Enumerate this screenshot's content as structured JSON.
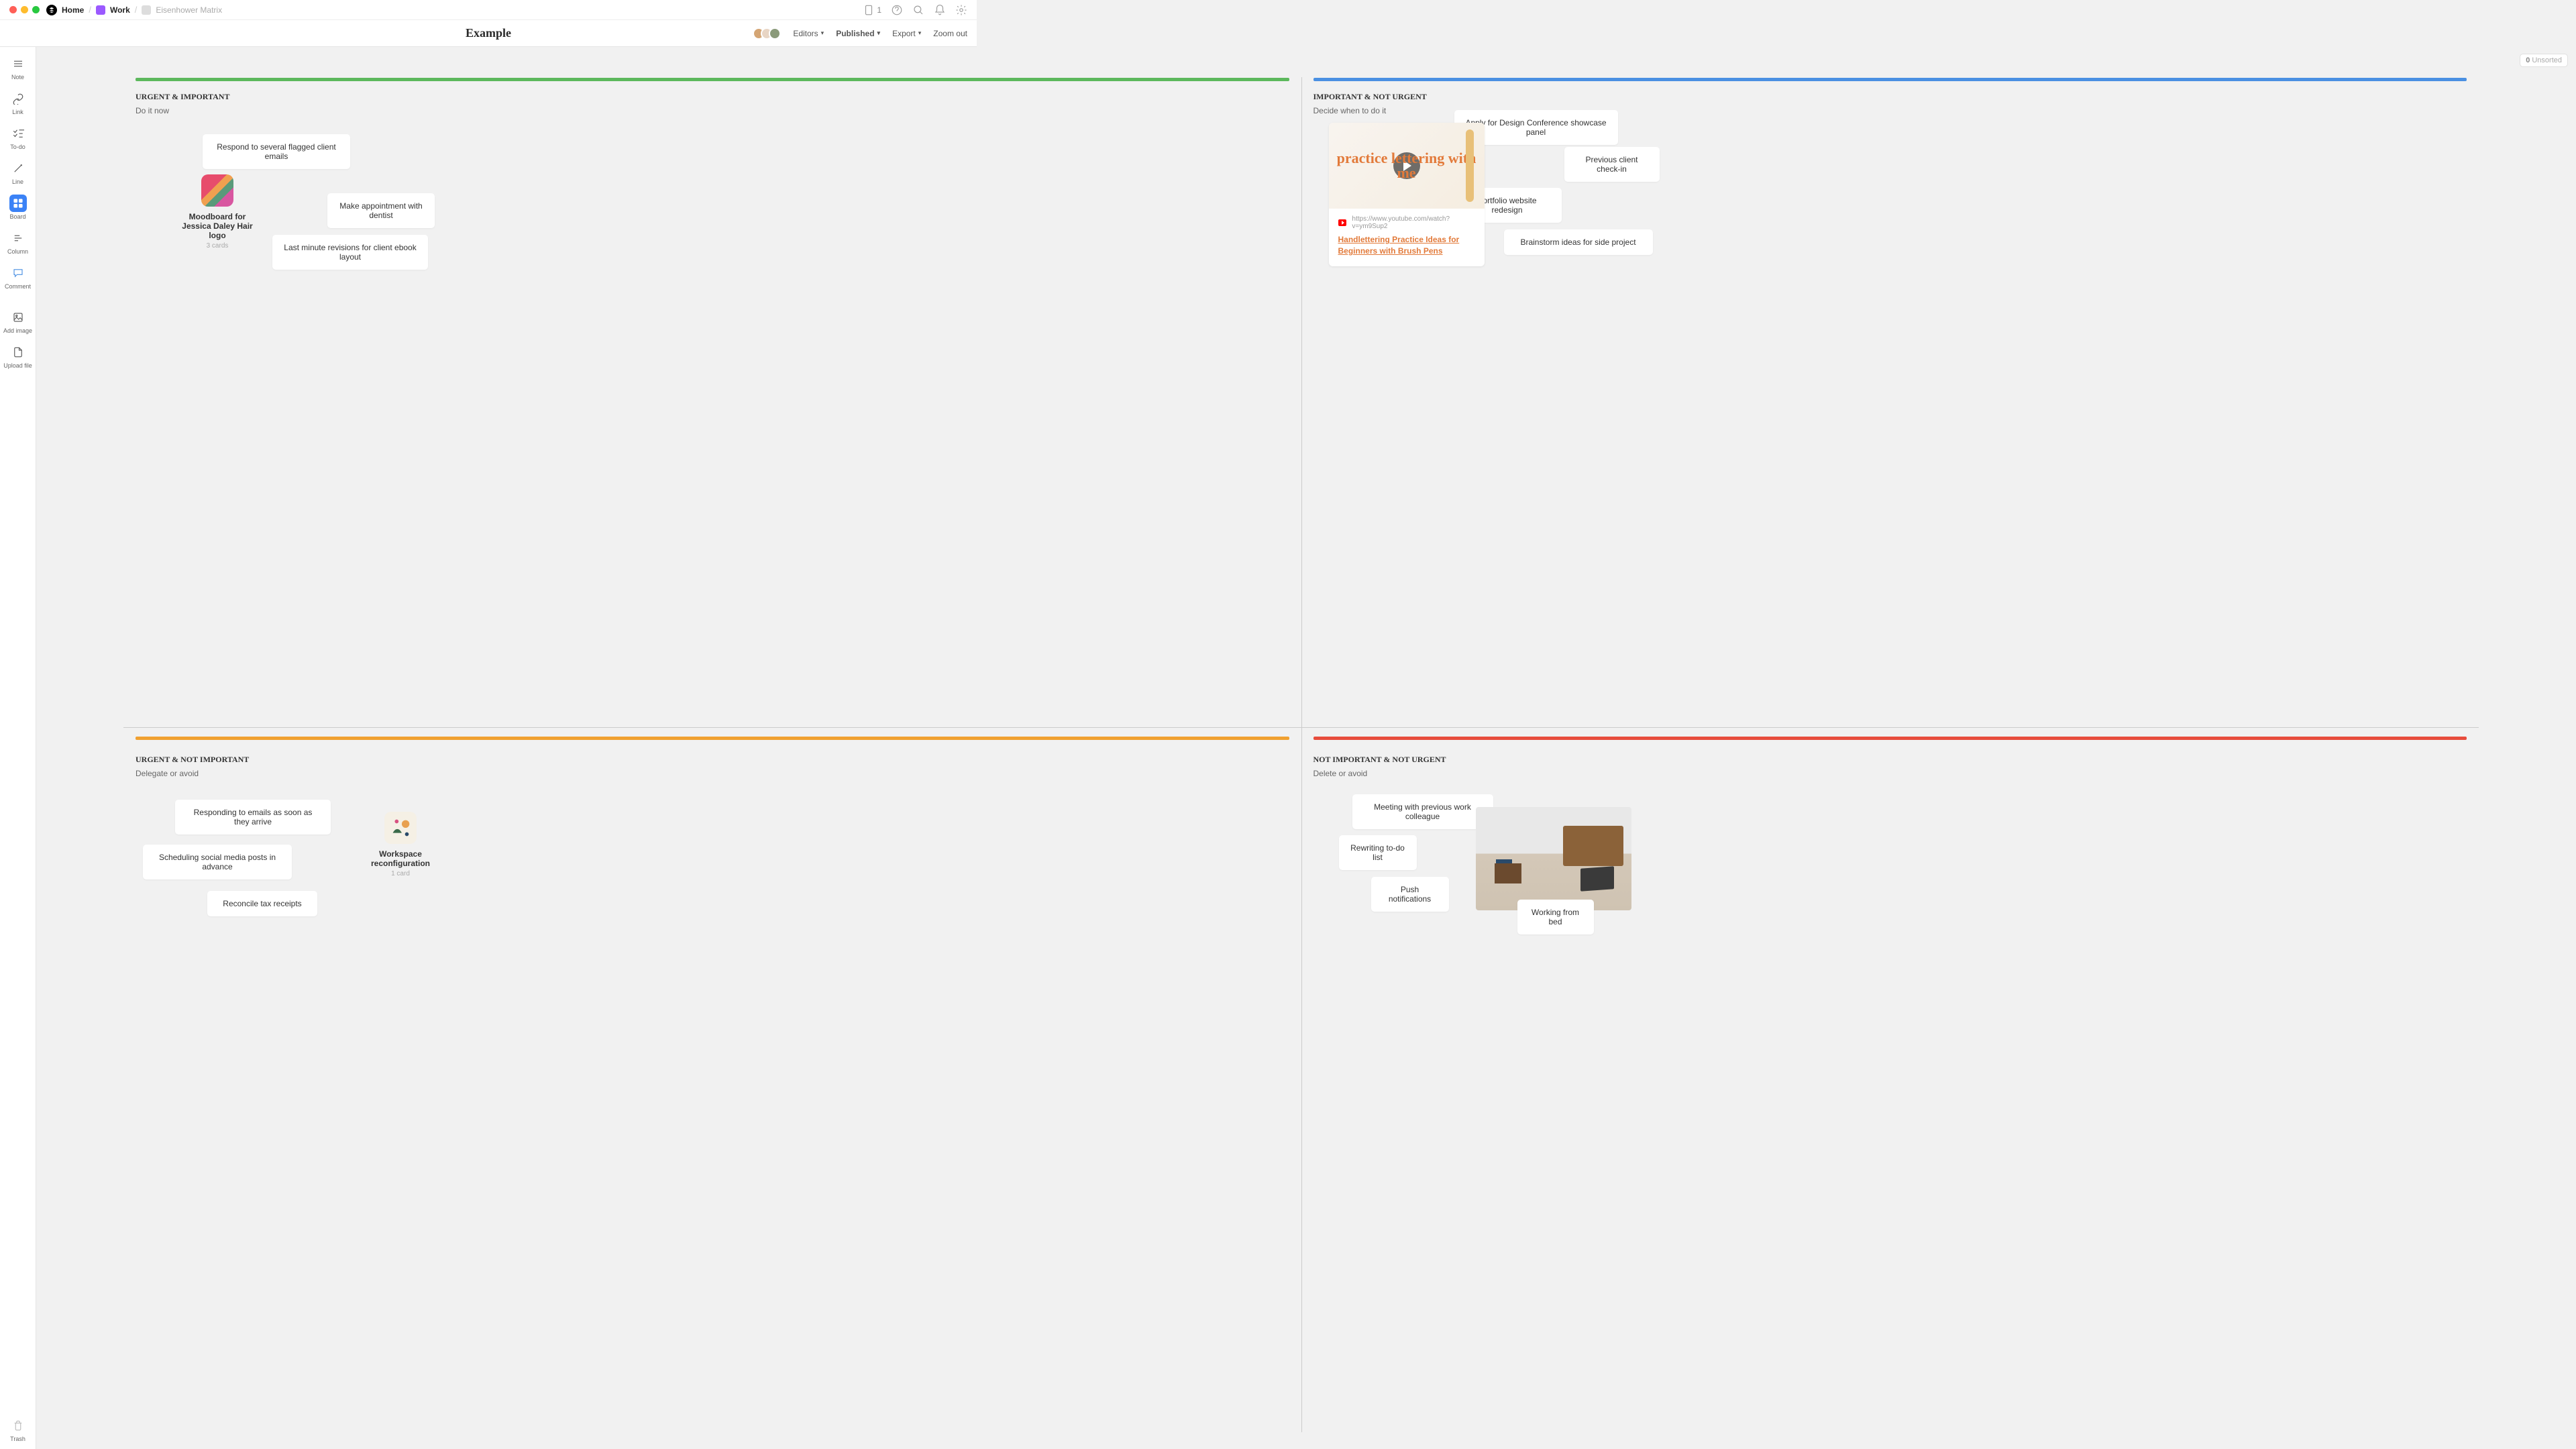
{
  "breadcrumb": {
    "home": "Home",
    "work": "Work",
    "page": "Eisenhower Matrix"
  },
  "badge_count": "1",
  "title": "Example",
  "header": {
    "editors": "Editors",
    "published": "Published",
    "export": "Export",
    "zoom": "Zoom out"
  },
  "sidebar": {
    "note": "Note",
    "link": "Link",
    "todo": "To-do",
    "line": "Line",
    "board": "Board",
    "column": "Column",
    "comment": "Comment",
    "image": "Add image",
    "upload": "Upload file",
    "trash": "Trash"
  },
  "unsorted_count": "0",
  "unsorted_label": "Unsorted",
  "q1": {
    "title": "URGENT & IMPORTANT",
    "sub": "Do it now",
    "cards": {
      "emails": "Respond to several flagged client emails",
      "appt": "Make appointment with dentist",
      "revisions": "Last minute revisions for client ebook layout"
    },
    "board": {
      "name": "Moodboard for Jessica Daley Hair logo",
      "count": "3 cards"
    }
  },
  "q2": {
    "title": "IMPORTANT & NOT URGENT",
    "sub": "Decide when to do it",
    "cards": {
      "conf": "Apply for Design Conference showcase panel",
      "prev": "Previous client check-in",
      "portfolio": "Portfolio website redesign",
      "brainstorm": "Brainstorm ideas for side project"
    },
    "video": {
      "url": "https://www.youtube.com/watch?v=ym9Sup2",
      "title": "Handlettering Practice Ideas for Beginners with Brush Pens",
      "thumb_text": "practice lettering with me"
    }
  },
  "q3": {
    "title": "URGENT & NOT IMPORTANT",
    "sub": "Delegate or avoid",
    "cards": {
      "respond": "Responding to emails as soon as they arrive",
      "social": "Scheduling social media posts in advance",
      "tax": "Reconcile tax receipts"
    },
    "board": {
      "name": "Workspace reconfiguration",
      "count": "1 card"
    }
  },
  "q4": {
    "title": "NOT IMPORTANT & NOT URGENT",
    "sub": "Delete or avoid",
    "cards": {
      "meeting": "Meeting with previous work colleague",
      "rewrite": "Rewriting to-do list",
      "push": "Push notifications",
      "bed": "Working from bed"
    }
  }
}
